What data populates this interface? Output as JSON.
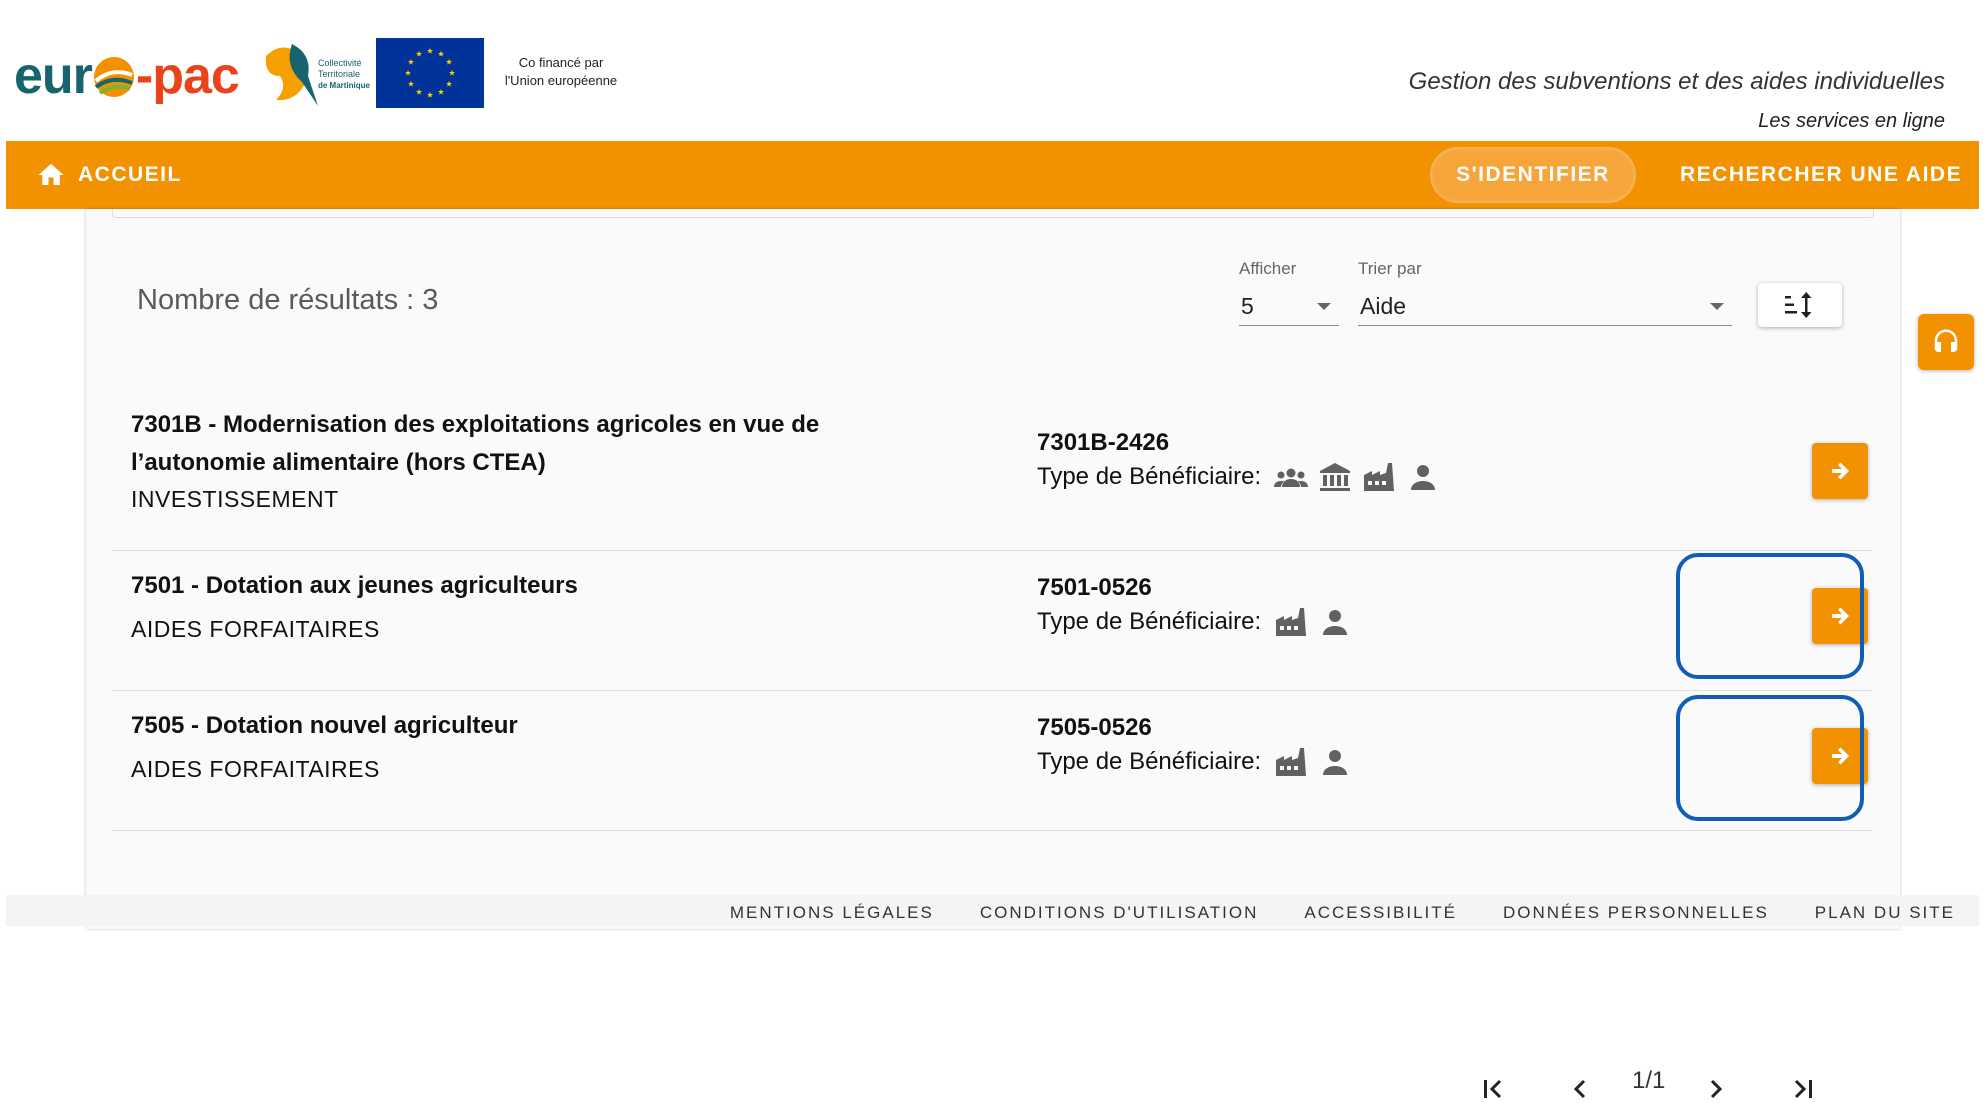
{
  "header": {
    "logo_text_left": "eur",
    "logo_text_right": "-pac",
    "ctm_lines": [
      "Collectivité",
      "Territoriale",
      "de Martinique"
    ],
    "cofinance_line1": "Co financé par",
    "cofinance_line2": "l'Union européenne",
    "tagline": "Gestion des subventions et des aides individuelles",
    "subtagline": "Les services en ligne"
  },
  "nav": {
    "home": "ACCUEIL",
    "login": "S'IDENTIFIER",
    "search": "RECHERCHER UNE AIDE"
  },
  "results": {
    "count_label": "Nombre de résultats : 3",
    "show_label": "Afficher",
    "show_value": "5",
    "sort_label": "Trier par",
    "sort_value": "Aide",
    "benef_label": "Type de Bénéficiaire:",
    "items": [
      {
        "title_line1": "7301B - Modernisation des exploitations agricoles en vue de",
        "title_line2": "l’autonomie alimentaire (hors CTEA)",
        "type": "INVESTISSEMENT",
        "code": "7301B-2426",
        "beneficiaries": [
          "group-icon",
          "bank-icon",
          "factory-icon",
          "person-icon"
        ]
      },
      {
        "title_line1": "7501 - Dotation aux jeunes agriculteurs",
        "type": "AIDES FORFAITAIRES",
        "code": "7501-0526",
        "beneficiaries": [
          "factory-icon",
          "person-icon"
        ]
      },
      {
        "title_line1": "7505 - Dotation nouvel agriculteur",
        "type": "AIDES FORFAITAIRES",
        "code": "7505-0526",
        "beneficiaries": [
          "factory-icon",
          "person-icon"
        ]
      }
    ]
  },
  "pagination": {
    "page": "1/1"
  },
  "footer": {
    "links": [
      "MENTIONS LÉGALES",
      "CONDITIONS D'UTILISATION",
      "ACCESSIBILITÉ",
      "DONNÉES PERSONNELLES",
      "PLAN DU SITE"
    ]
  },
  "colors": {
    "accent": "#f39200",
    "highlight": "#0f5db6",
    "brand_teal": "#16646e",
    "brand_red": "#e8431a"
  }
}
